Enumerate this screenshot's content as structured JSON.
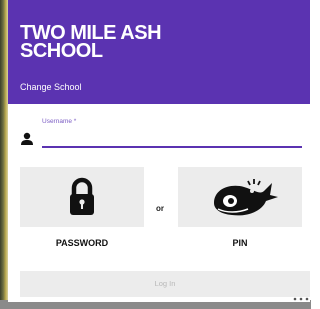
{
  "header": {
    "school_name": "TWO MILE ASH SCHOOL",
    "change_school": "Change School",
    "background_color": "#5b33b1"
  },
  "login": {
    "username_label": "Username *",
    "username_value": "",
    "accent_color": "#5b33b1"
  },
  "options": {
    "password_label": "PASSWORD",
    "or_label": "or",
    "pin_label": "PIN",
    "password_icon": "padlock-icon",
    "pin_icon": "whale-icon"
  },
  "actions": {
    "login_label": "Log In",
    "login_enabled": false
  }
}
